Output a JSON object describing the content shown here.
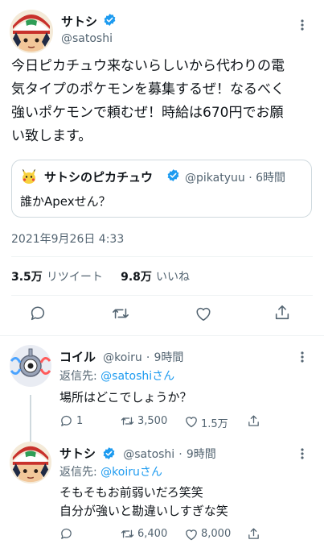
{
  "colors": {
    "accent": "#1d9bf0",
    "muted": "#536471",
    "text": "#0f1419",
    "border": "#cfd9de"
  },
  "main_tweet": {
    "name": "サトシ",
    "handle": "@satoshi",
    "text_lines": [
      "今日ピカチュウ来ないらしいから代わりの電",
      "気タイプのポケモンを募集するぜ！なるべく",
      "強いポケモンで頼むぜ！時給は670円でお願",
      "い致します。"
    ],
    "quote": {
      "name": "サトシのピカチュウ",
      "handle": "@pikatyuu",
      "separator": "·",
      "time": "6時間",
      "text": "誰かApexせん？"
    },
    "timestamp": "2021年9月26日 4:33",
    "retweets_count": "3.5万",
    "retweets_label": "リツイート",
    "likes_count": "9.8万",
    "likes_label": "いいね"
  },
  "replies": [
    {
      "name": "コイル",
      "handle": "@koiru",
      "separator": "·",
      "time": "9時間",
      "reply_prefix": "返信先: ",
      "reply_handle": "@satoshi",
      "reply_suffix": "さん",
      "text_lines": [
        "場所はどこでしょうか？"
      ],
      "reply_count": "1",
      "retweet_count": "3,500",
      "like_count": "1.5万"
    },
    {
      "name": "サトシ",
      "handle": "@satoshi",
      "separator": "·",
      "time": "9時間",
      "reply_prefix": "返信先: ",
      "reply_handle": "@koiru",
      "reply_suffix": "さん",
      "text_lines": [
        "そもそもお前弱いだろ笑笑",
        "自分が強いと勘違いしすぎな笑"
      ],
      "reply_count": "",
      "retweet_count": "6,400",
      "like_count": "8,000"
    }
  ]
}
